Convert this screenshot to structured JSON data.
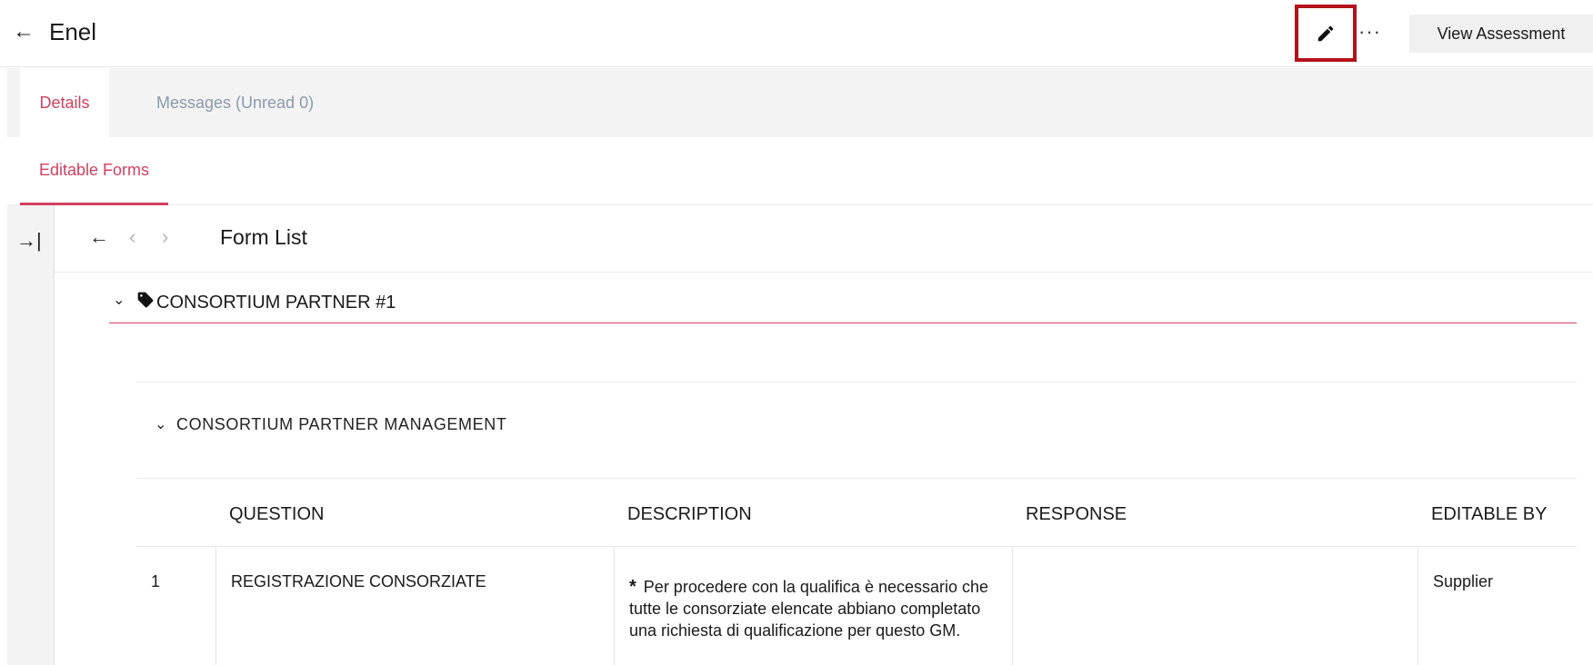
{
  "header": {
    "title": "Enel",
    "back_icon": "←",
    "more_icon": "···",
    "view_assessment_label": "View Assessment"
  },
  "tabs": [
    {
      "label": "Details",
      "active": true
    },
    {
      "label": "Messages (Unread 0)",
      "active": false
    }
  ],
  "subtabs": [
    {
      "label": "Editable Forms",
      "active": true
    }
  ],
  "form_list": {
    "collapse_icon": "→|",
    "back_icon": "←",
    "prev_icon": "‹",
    "next_icon": "›",
    "title": "Form List"
  },
  "section": {
    "chevron": "⌄",
    "title": "CONSORTIUM PARTNER #1"
  },
  "subsection": {
    "chevron": "⌄",
    "title": "CONSORTIUM PARTNER MANAGEMENT"
  },
  "table": {
    "columns": [
      "QUESTION",
      "DESCRIPTION",
      "RESPONSE",
      "EDITABLE BY"
    ],
    "rows": [
      {
        "number": "1",
        "question": "REGISTRAZIONE CONSORZIATE",
        "asterisk": "*",
        "description": "Per procedere con la qualifica è necessario che tutte le consorziate elencate abbiano completato una richiesta di qualificazione per questo GM.",
        "response": "",
        "editable_by": "Supplier"
      }
    ]
  },
  "colors": {
    "accent": "#d1415f",
    "highlight_box": "#b3121b",
    "muted_tab": "#8a99ab"
  }
}
